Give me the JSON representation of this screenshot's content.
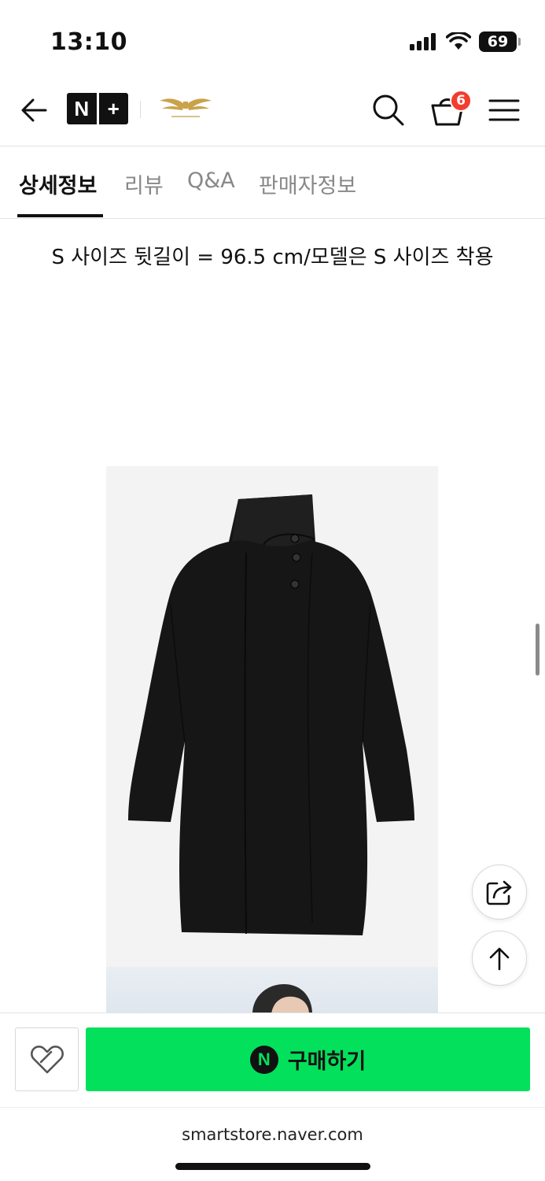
{
  "status": {
    "time": "13:10",
    "battery": "69",
    "icons": [
      "cellular-signal-icon",
      "wifi-icon",
      "battery-icon"
    ]
  },
  "header": {
    "logo_letter": "N",
    "logo_plus": "+",
    "cart_count": "6",
    "icons": [
      "back-arrow-icon",
      "search-icon",
      "cart-icon",
      "menu-icon"
    ]
  },
  "tabs": [
    {
      "label": "상세정보",
      "active": true
    },
    {
      "label": "리뷰",
      "active": false
    },
    {
      "label": "Q&A",
      "active": false
    },
    {
      "label": "판매자정보",
      "active": false
    }
  ],
  "content": {
    "size_note": "S 사이즈 뒷길이 = 96.5 cm/모델은 S 사이즈 착용"
  },
  "floating": {
    "icons": [
      "share-icon",
      "scroll-top-icon"
    ]
  },
  "bottom_bar": {
    "buy_icon_letter": "N",
    "buy_label": "구매하기"
  },
  "browser": {
    "url": "smartstore.naver.com"
  },
  "colors": {
    "buy_button": "#03e05c",
    "cart_badge": "#f33c2f",
    "brand_gold": "#c9a24a"
  }
}
